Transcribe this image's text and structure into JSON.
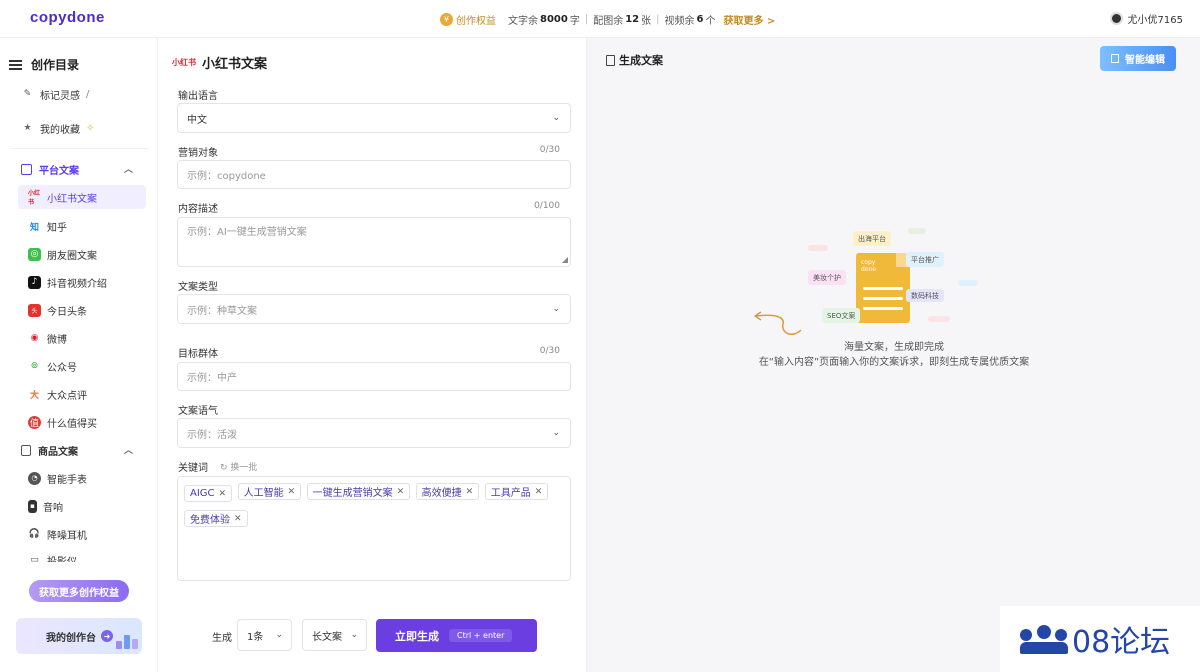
{
  "header": {
    "logo": "copydone",
    "quota": {
      "rights_label": "创作权益",
      "text_prefix": "文字余",
      "text_count": "8000",
      "text_unit": "字",
      "image_prefix": "配图余",
      "image_count": "12",
      "image_unit": "张",
      "video_prefix": "视频余",
      "video_count": "6",
      "video_unit": "个",
      "more": "获取更多 >"
    },
    "username": "尤小优7165"
  },
  "sidebar": {
    "title": "创作目录",
    "top_items": [
      {
        "label": "标记灵感",
        "icon": "bookmark-icon"
      },
      {
        "label": "我的收藏",
        "icon": "star-icon"
      }
    ],
    "platform_section": {
      "label": "平台文案",
      "items": [
        {
          "label": "小红书文案",
          "icon": "xiaohongshu-icon",
          "active": true
        },
        {
          "label": "知乎",
          "icon": "zhihu-icon"
        },
        {
          "label": "朋友圈文案",
          "icon": "wechat-moments-icon"
        },
        {
          "label": "抖音视频介绍",
          "icon": "douyin-icon"
        },
        {
          "label": "今日头条",
          "icon": "toutiao-icon"
        },
        {
          "label": "微博",
          "icon": "weibo-icon"
        },
        {
          "label": "公众号",
          "icon": "wechat-official-icon"
        },
        {
          "label": "大众点评",
          "icon": "dianping-icon"
        },
        {
          "label": "什么值得买",
          "icon": "smzdm-icon"
        }
      ]
    },
    "product_section": {
      "label": "商品文案",
      "items": [
        {
          "label": "智能手表",
          "icon": "smartwatch-icon"
        },
        {
          "label": "音响",
          "icon": "speaker-icon"
        },
        {
          "label": "降噪耳机",
          "icon": "headphones-icon"
        },
        {
          "label": "投影仪",
          "icon": "projector-icon"
        }
      ]
    },
    "get_more_button": "获取更多创作权益",
    "workbench": "我的创作台"
  },
  "form": {
    "title_logo": "小红书",
    "title": "小红书文案",
    "language": {
      "label": "输出语言",
      "value": "中文"
    },
    "target": {
      "label": "营销对象",
      "count": "0/30",
      "placeholder": "示例：copydone"
    },
    "description": {
      "label": "内容描述",
      "count": "0/100",
      "placeholder": "示例：AI一键生成营销文案"
    },
    "copy_type": {
      "label": "文案类型",
      "placeholder": "示例：种草文案"
    },
    "audience": {
      "label": "目标群体",
      "count": "0/30",
      "placeholder": "示例：中产"
    },
    "tone": {
      "label": "文案语气",
      "placeholder": "示例：活泼"
    },
    "keywords": {
      "label": "关键词",
      "refresh": "换一批",
      "chips": [
        "AIGC",
        "人工智能",
        "一键生成营销文案",
        "高效便捷",
        "工具产品",
        "免费体验"
      ]
    },
    "bottom": {
      "gen_label": "生成",
      "count_select": "1条",
      "length_select": "长文案",
      "generate_button": "立即生成",
      "shortcut": "Ctrl + enter"
    }
  },
  "result": {
    "title": "生成文案",
    "smart_edit": "智能编辑",
    "illustration": {
      "doc_text": "copy done",
      "tags": [
        "出海平台",
        "平台推广",
        "美妆个护",
        "数码科技",
        "SEO文案"
      ]
    },
    "hint_line1": "海量文案，生成即完成",
    "hint_line2": "在“输入内容”页面输入你的文案诉求，即刻生成专属优质文案"
  },
  "watermark": "08论坛"
}
